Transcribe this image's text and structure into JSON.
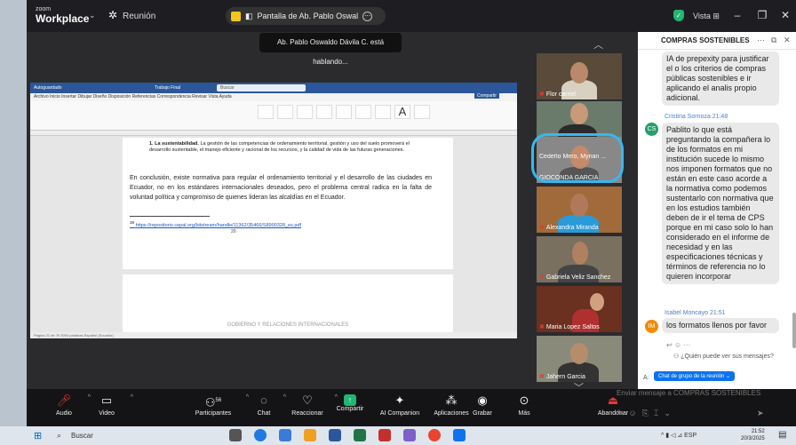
{
  "titlebar": {
    "brand_small": "zoom",
    "brand": "Workplace",
    "meeting_label": "Reunión",
    "share_text": "Pantalla de Ab. Pablo Oswal",
    "view_label": "Vista"
  },
  "speaking_banner": "Ab. Pablo Oswaldo Dávila C. está hablando...",
  "word": {
    "autosave_label": "Autoguardado",
    "file_name": "Trabajo Final",
    "search_placeholder": "Buscar",
    "tabs": "Archivo   Inicio   Insertar   Dibujar   Diseño   Disposición   Referencias   Correspondencia   Revisar   Vista   Ayuda",
    "compartir": "Compartir",
    "item_bold": "1. La sustentabilidad.",
    "item_text": " La gestión de las competencias de ordenamiento territorial, gestión y uso del suelo promoverá el desarrollo sustentable, el manejo eficiente y racional de los recursos, y la calidad de vida de las futuras generaciones.",
    "paragraph": "En conclusión, existe normativa para regular el ordenamiento territorial y el desarrollo de las ciudades en Ecuador, no en los estándares internacionales deseados, pero el problema central radica en la falta de voluntad política y compromiso de quienes lideran las alcaldías en el Ecuador.",
    "footnote_num": "38",
    "footnote_link": "https://repositorio.cepal.org/bitstream/handle/11362/35466/S8900328_es.pdf",
    "page_number": "20",
    "page_header": "GOBIERNO Y RELACIONES INTERNACIONALES",
    "status_left": "Página 21 de 76     3004 palabras     Español (Ecuador)"
  },
  "participants": [
    {
      "name": "Flor carriel"
    },
    {
      "name": "Cedeño Mero, Myrian ..."
    },
    {
      "name": "GIOCONDA GARCIA"
    },
    {
      "name": "Alexandra Miranda"
    },
    {
      "name": "Gabriela Veliz Sanchez"
    },
    {
      "name": "Maria Lopez Saltos"
    },
    {
      "name": "Jahern Garcia"
    }
  ],
  "toolbar": {
    "audio": "Audio",
    "video": "Video",
    "participants": "Participantes",
    "participants_count": "56",
    "chat": "Chat",
    "react": "Reaccionar",
    "share": "Compartir",
    "companion": "AI Companion",
    "apps": "Aplicaciones",
    "record": "Grabar",
    "more": "Más",
    "end": "Abandonar"
  },
  "chat": {
    "title": "COMPRAS SOSTENIBLES",
    "msg0": "IA de prepexity para justificar el o los criterios de compras públicas sostenibles e ir aplicando el analis propio adicional.",
    "sender1": "Cristina Sornoza 21:48",
    "avatar1": "CS",
    "msg1": "Pablito lo que está preguntando la compañera lo de los formatos en mi institución sucede lo mismo nos imponen formatos que no están en este caso acorde a la normativa como podemos sustentarlo con normativa que en los estudios también deben de ir el tema de CPS porque en mi caso solo lo han considerado en el informe de necesidad y en las especificaciones técnicas y términos de referencia no lo quieren incorporar",
    "sender2": "Isabel Moncayo 21:51",
    "avatar2": "IM",
    "msg2": "los formatos llenos por favor",
    "hint": "¿Quién puede ver sus mensajes?",
    "to_label": "A:",
    "to_chip": "Chat de grupo de la reunión",
    "input_placeholder": "Enviar mensaje a COMPRAS SOSTENIBLES"
  },
  "taskbar": {
    "search": "Buscar",
    "lang": "ESP",
    "time": "21:52",
    "date": "20/3/2025"
  },
  "colors": {
    "accent": "#0e72ed",
    "word_blue": "#2b579a",
    "highlight": "#38b8f0",
    "share_green": "#22b573"
  }
}
